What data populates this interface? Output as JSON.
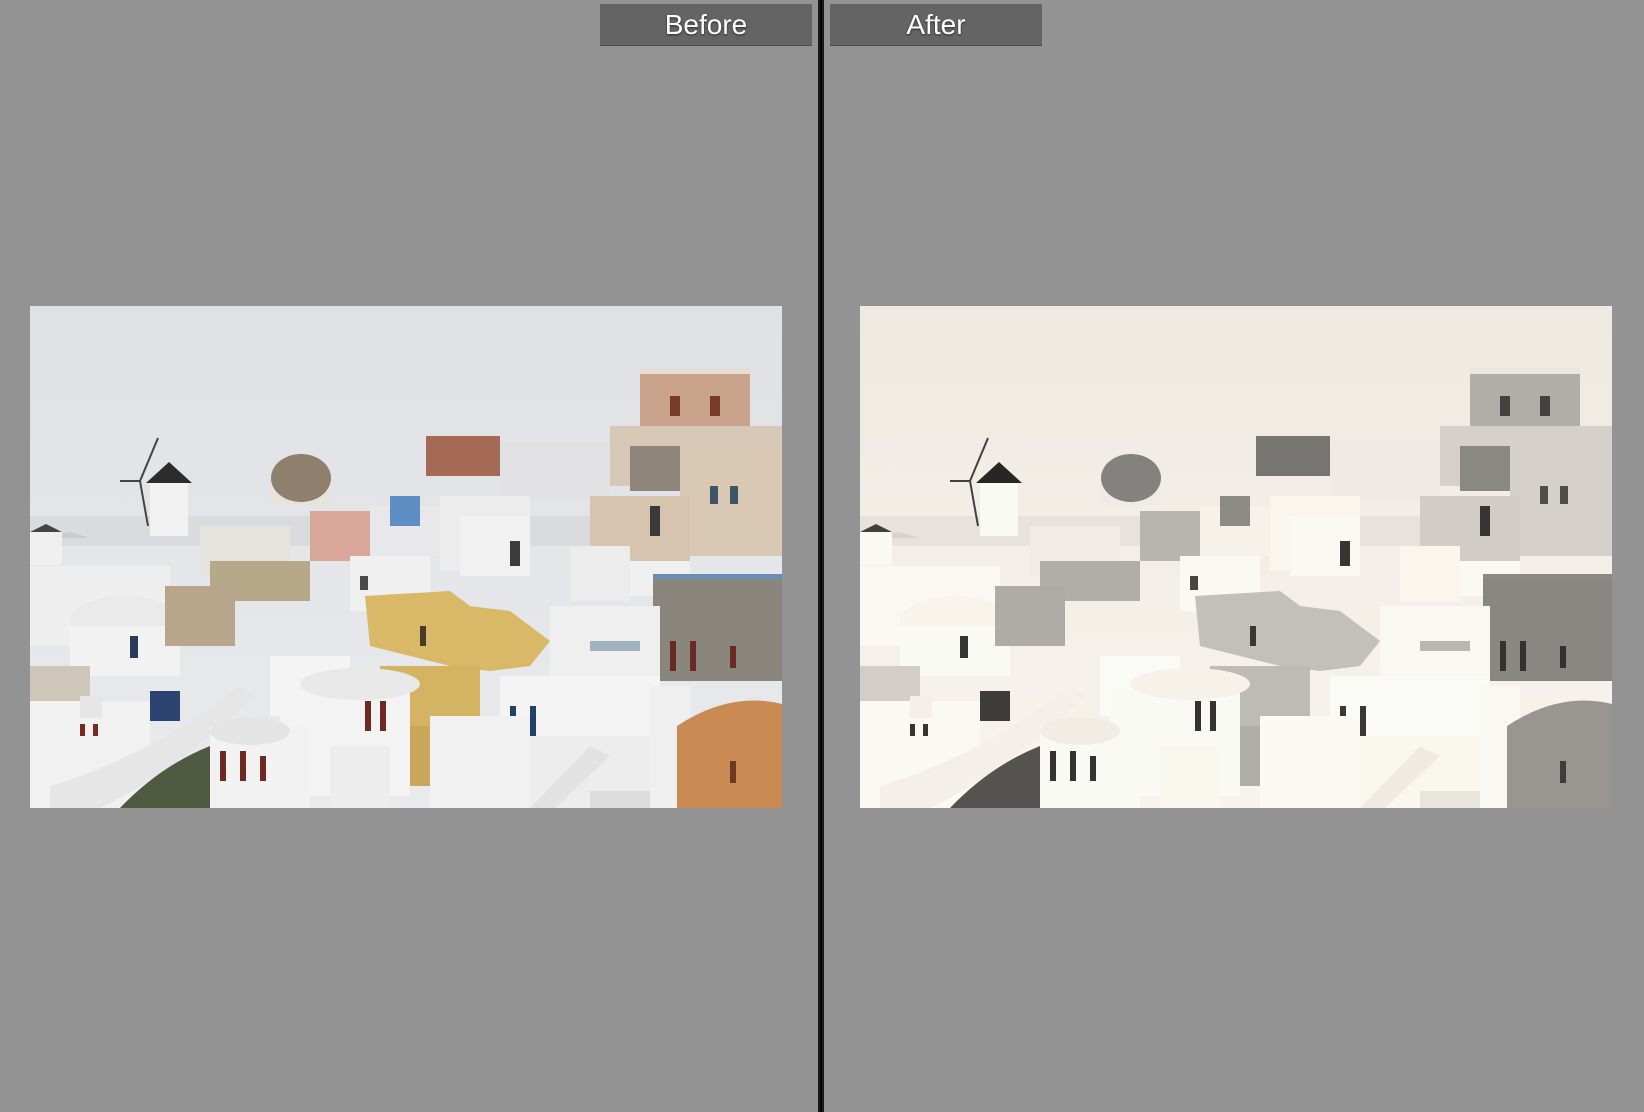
{
  "compare_view": {
    "before_label": "Before",
    "after_label": "After"
  },
  "colors": {
    "background": "#939393",
    "label_bg": "#646464",
    "divider": "#080808"
  }
}
